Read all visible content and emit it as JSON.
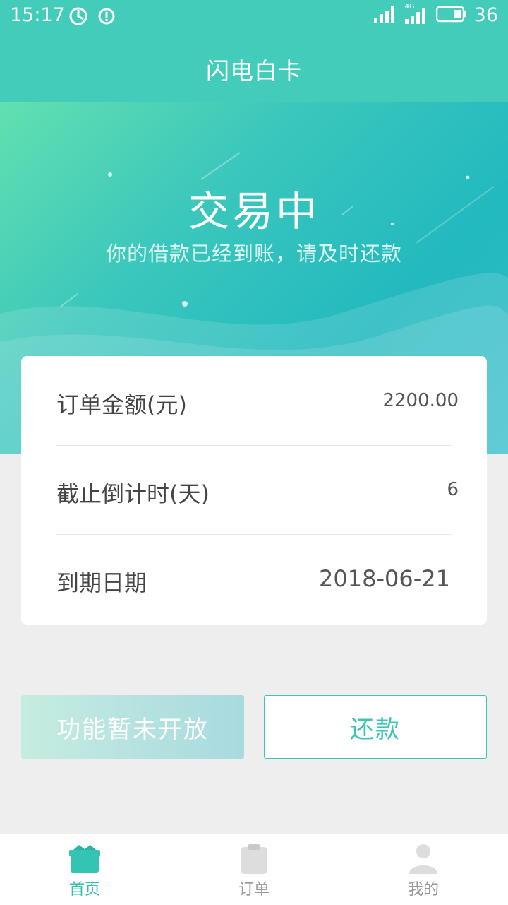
{
  "status_bar": {
    "time": "15:17",
    "signal_label": "4G",
    "battery": "36"
  },
  "nav": {
    "title": "闪电白卡"
  },
  "hero": {
    "title": "交易中",
    "subtitle": "你的借款已经到账，请及时还款"
  },
  "card": {
    "rows": [
      {
        "label": "订单金额(元)",
        "value": "2200.00"
      },
      {
        "label": "截止倒计时(天)",
        "value": "6"
      },
      {
        "label": "到期日期",
        "value": "2018-06-21"
      }
    ]
  },
  "actions": {
    "disabled_label": "功能暂未开放",
    "repay_label": "还款"
  },
  "tabs": [
    {
      "label": "首页",
      "icon": "home-icon",
      "active": true
    },
    {
      "label": "订单",
      "icon": "clipboard-icon",
      "active": false
    },
    {
      "label": "我的",
      "icon": "user-icon",
      "active": false
    }
  ],
  "colors": {
    "primary": "#44ccba",
    "accent_text": "#2fbfb0",
    "inactive_tab": "#999999"
  }
}
